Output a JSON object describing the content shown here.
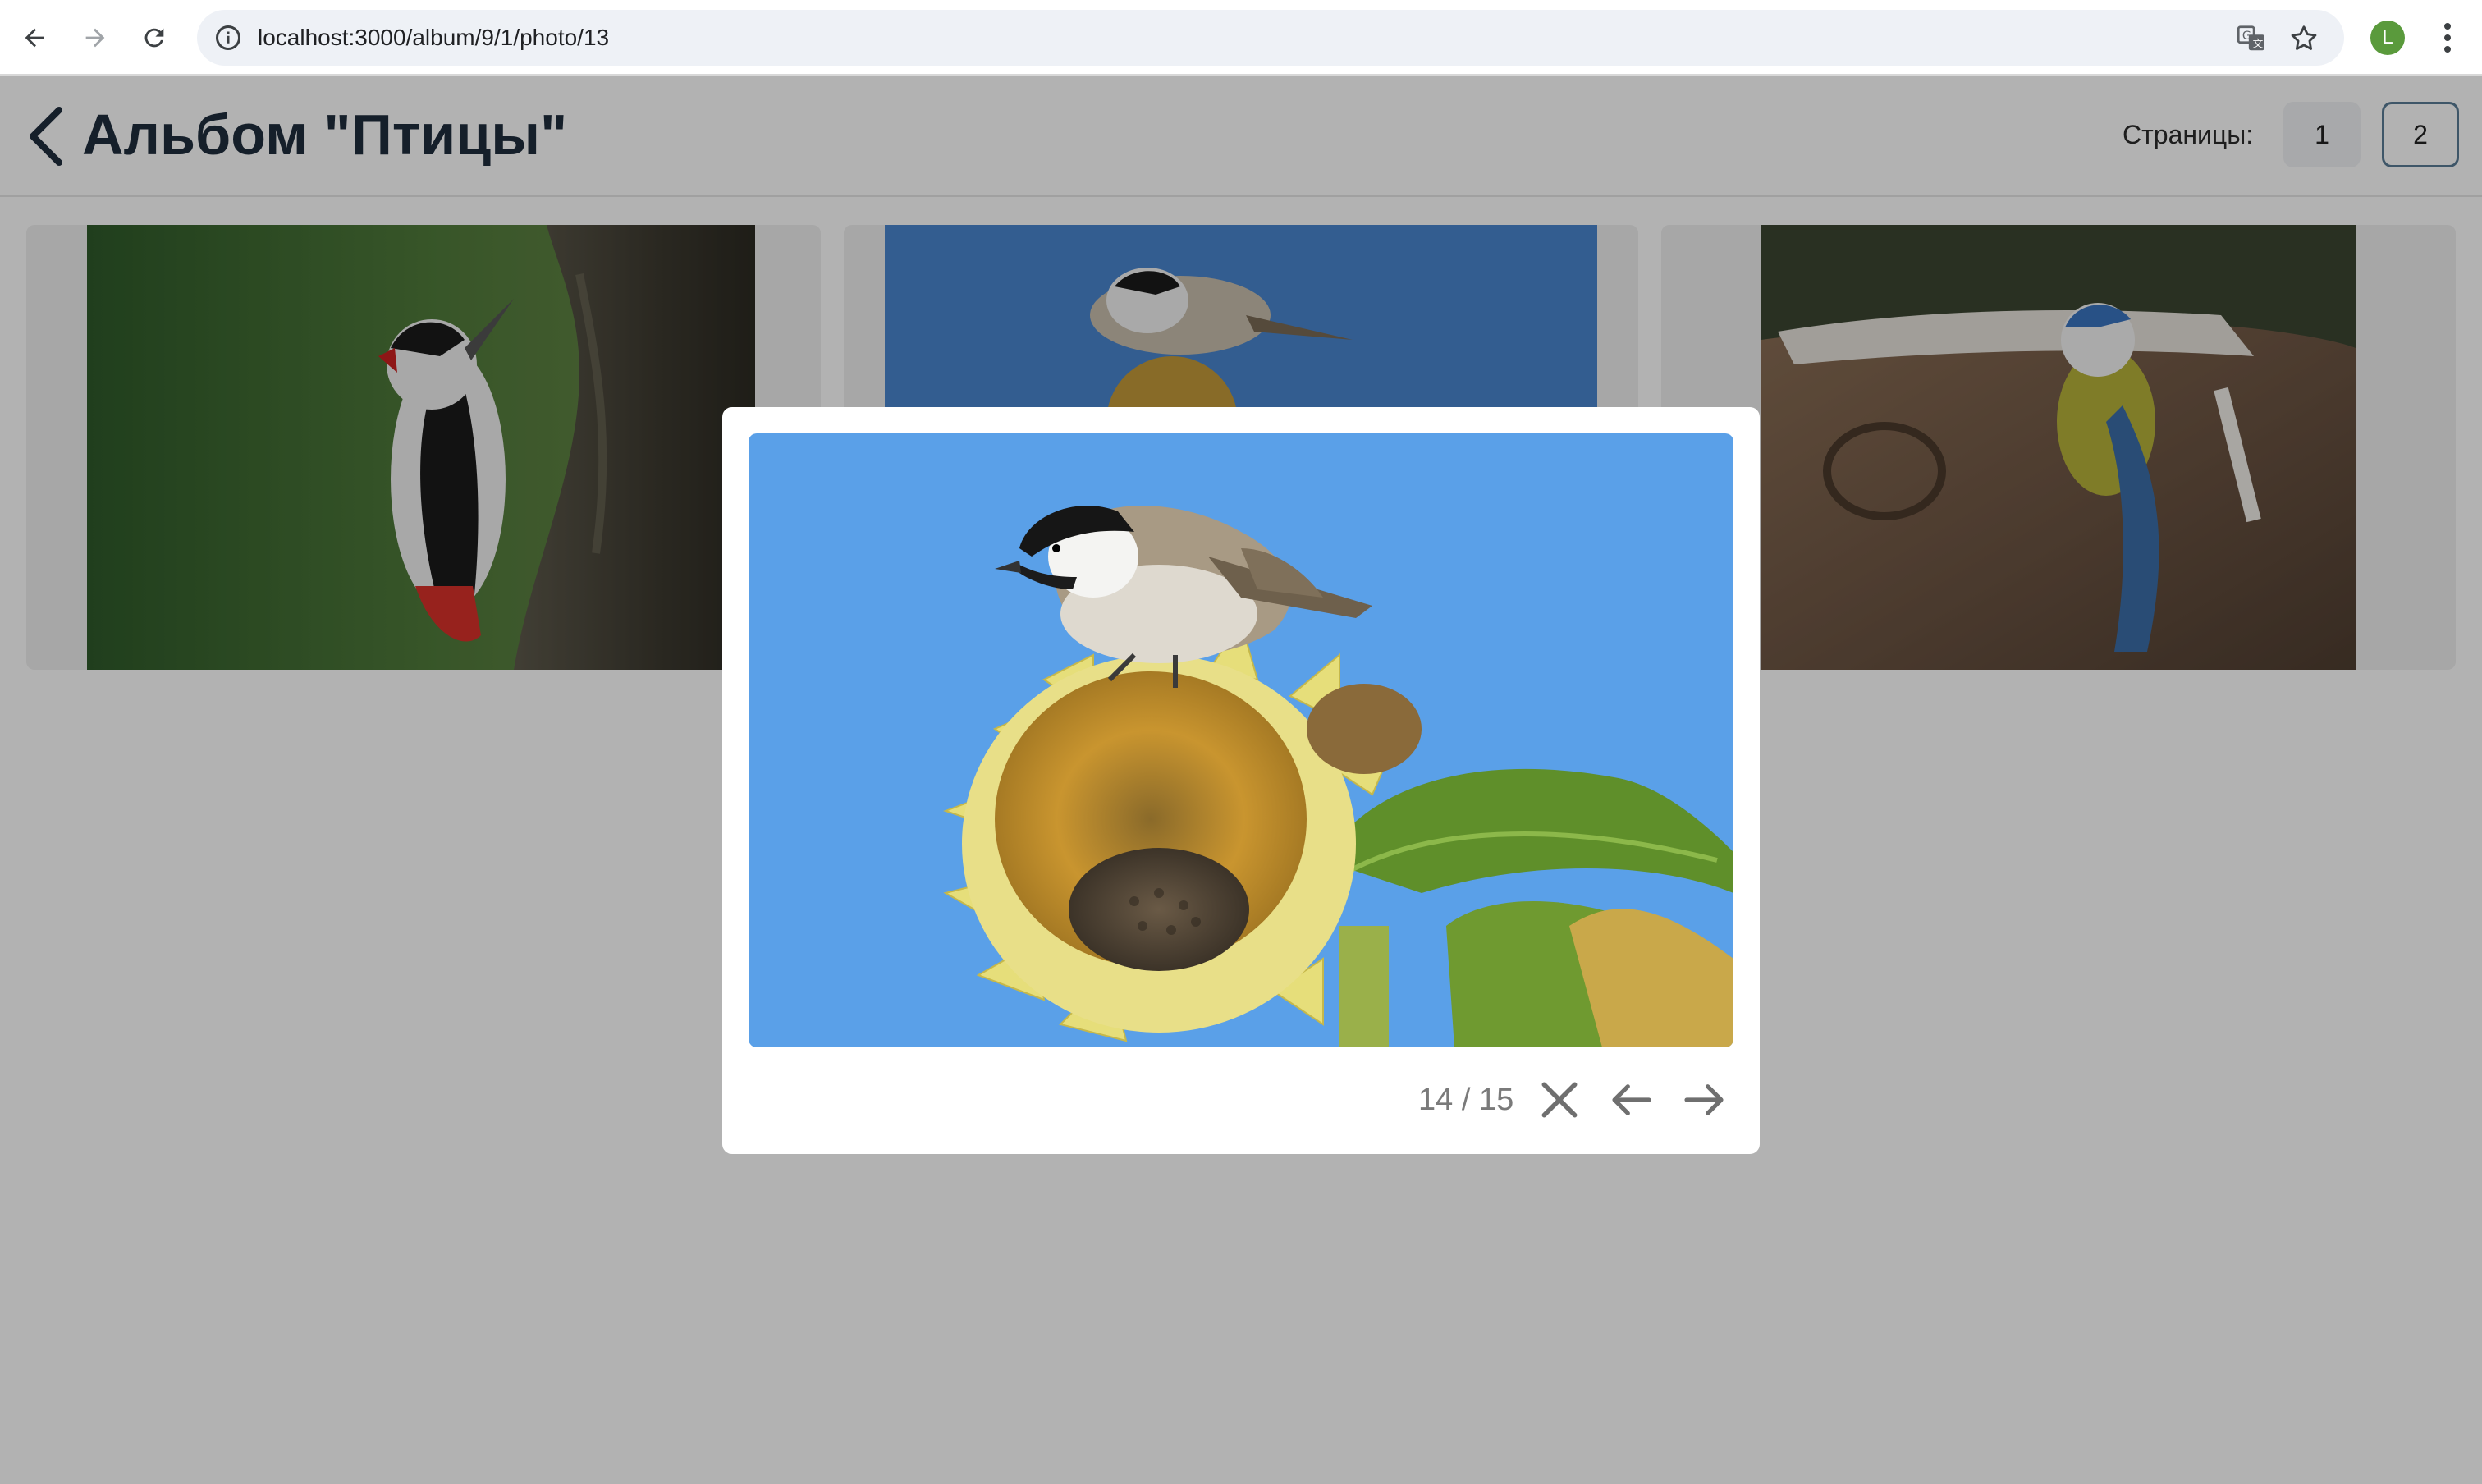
{
  "browser": {
    "url": "localhost:3000/album/9/1/photo/13",
    "profile_initial": "L",
    "icons": [
      "back-arrow-icon",
      "forward-arrow-icon",
      "reload-icon",
      "info-icon",
      "translate-icon",
      "star-icon",
      "more-vert-icon"
    ]
  },
  "header": {
    "title": "Альбом \"Птицы\"",
    "pages_label": "Страницы:",
    "pages": [
      "1",
      "2"
    ],
    "active_page": "2"
  },
  "grid": {
    "cards": [
      {
        "subject": "great spotted woodpecker on tree trunk"
      },
      {
        "subject": "tit on sunflower"
      },
      {
        "subject": "blue tit on snowy stump"
      }
    ]
  },
  "viewer": {
    "counter": "14 / 15",
    "photo_subject": "tit perched on sunflower against blue sky",
    "icons": [
      "close-icon",
      "arrow-left-icon",
      "arrow-right-icon"
    ]
  },
  "colors": {
    "title": "#1f2d3d",
    "active_page_border": "#5a7c96",
    "profile": "#5a9a3c",
    "overlay": "rgba(0,0,0,0.30)"
  }
}
